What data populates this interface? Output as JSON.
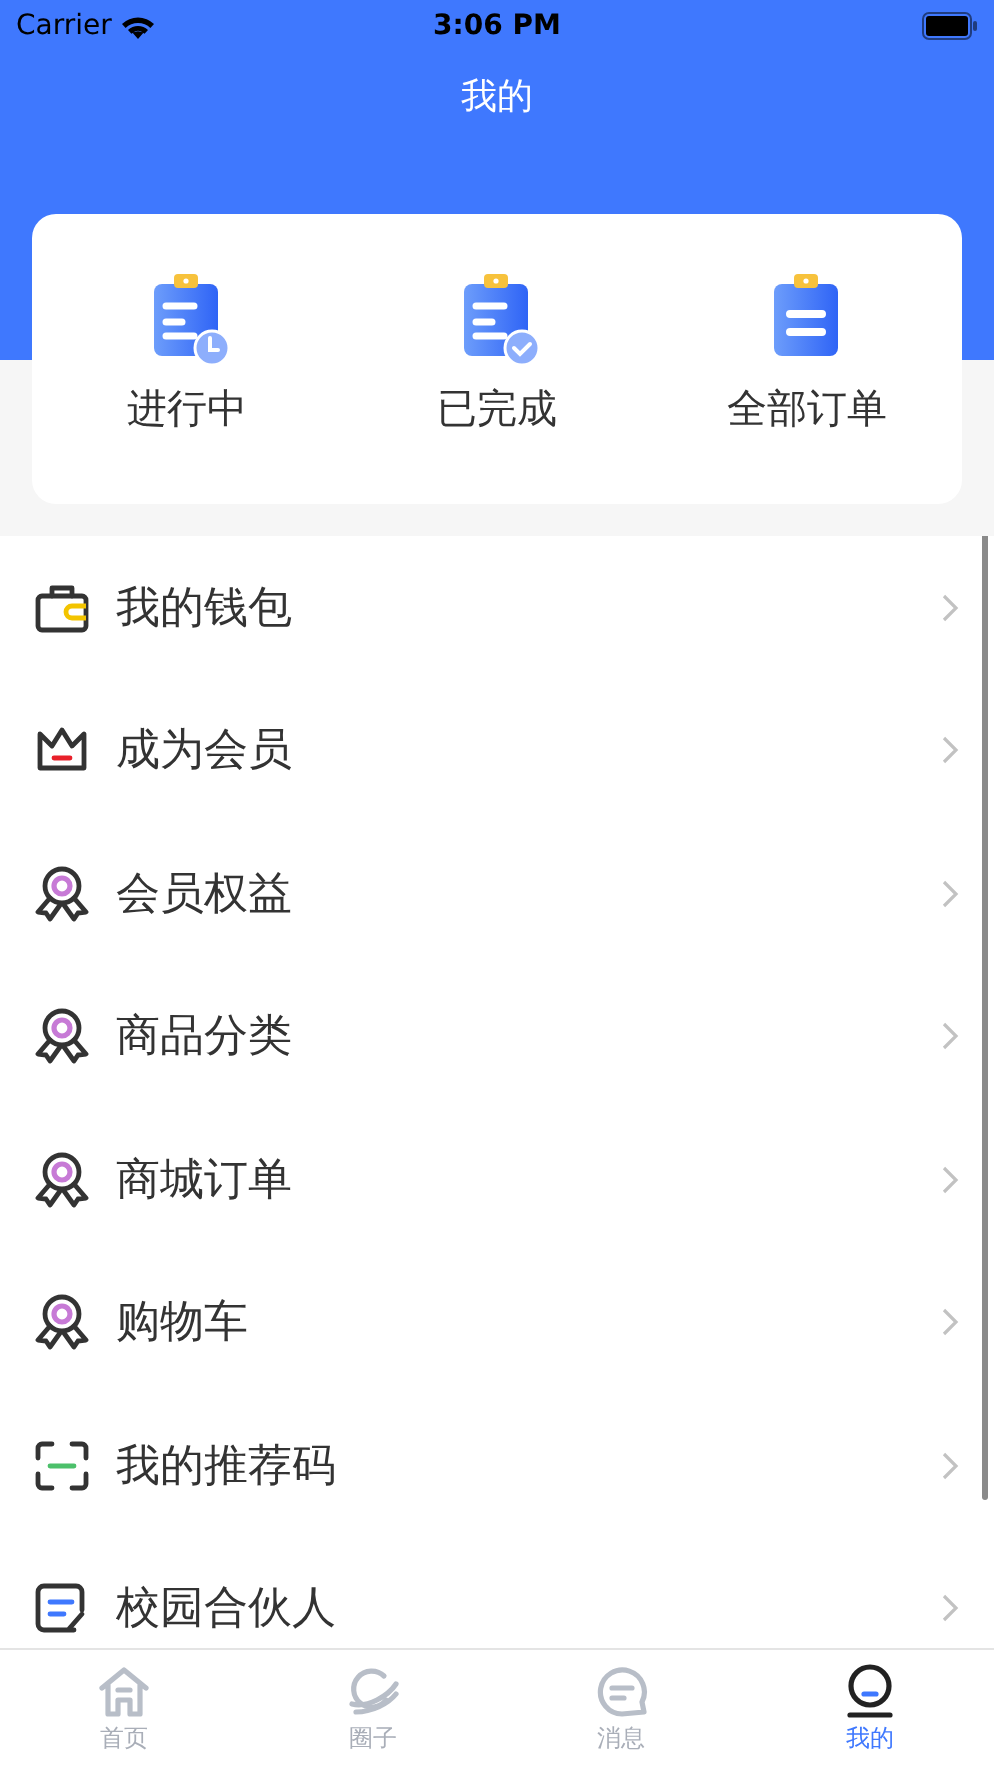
{
  "status_bar": {
    "carrier": "Carrier",
    "time": "3:06 PM"
  },
  "header": {
    "title": "我的"
  },
  "order_card": [
    {
      "kind": "pending",
      "label": "进行中"
    },
    {
      "kind": "done",
      "label": "已完成"
    },
    {
      "kind": "all",
      "label": "全部订单"
    }
  ],
  "menu": [
    {
      "kind": "wallet",
      "label": "我的钱包"
    },
    {
      "kind": "crown",
      "label": "成为会员"
    },
    {
      "kind": "medal",
      "label": "会员权益"
    },
    {
      "kind": "medal",
      "label": "商品分类"
    },
    {
      "kind": "medal",
      "label": "商城订单"
    },
    {
      "kind": "medal",
      "label": "购物车"
    },
    {
      "kind": "scan",
      "label": "我的推荐码"
    },
    {
      "kind": "note",
      "label": "校园合伙人"
    }
  ],
  "tab_bar": [
    {
      "kind": "home",
      "label": "首页",
      "selected": false
    },
    {
      "kind": "planet",
      "label": "圈子",
      "selected": false
    },
    {
      "kind": "chat",
      "label": "消息",
      "selected": false
    },
    {
      "kind": "profile",
      "label": "我的",
      "selected": true
    }
  ]
}
